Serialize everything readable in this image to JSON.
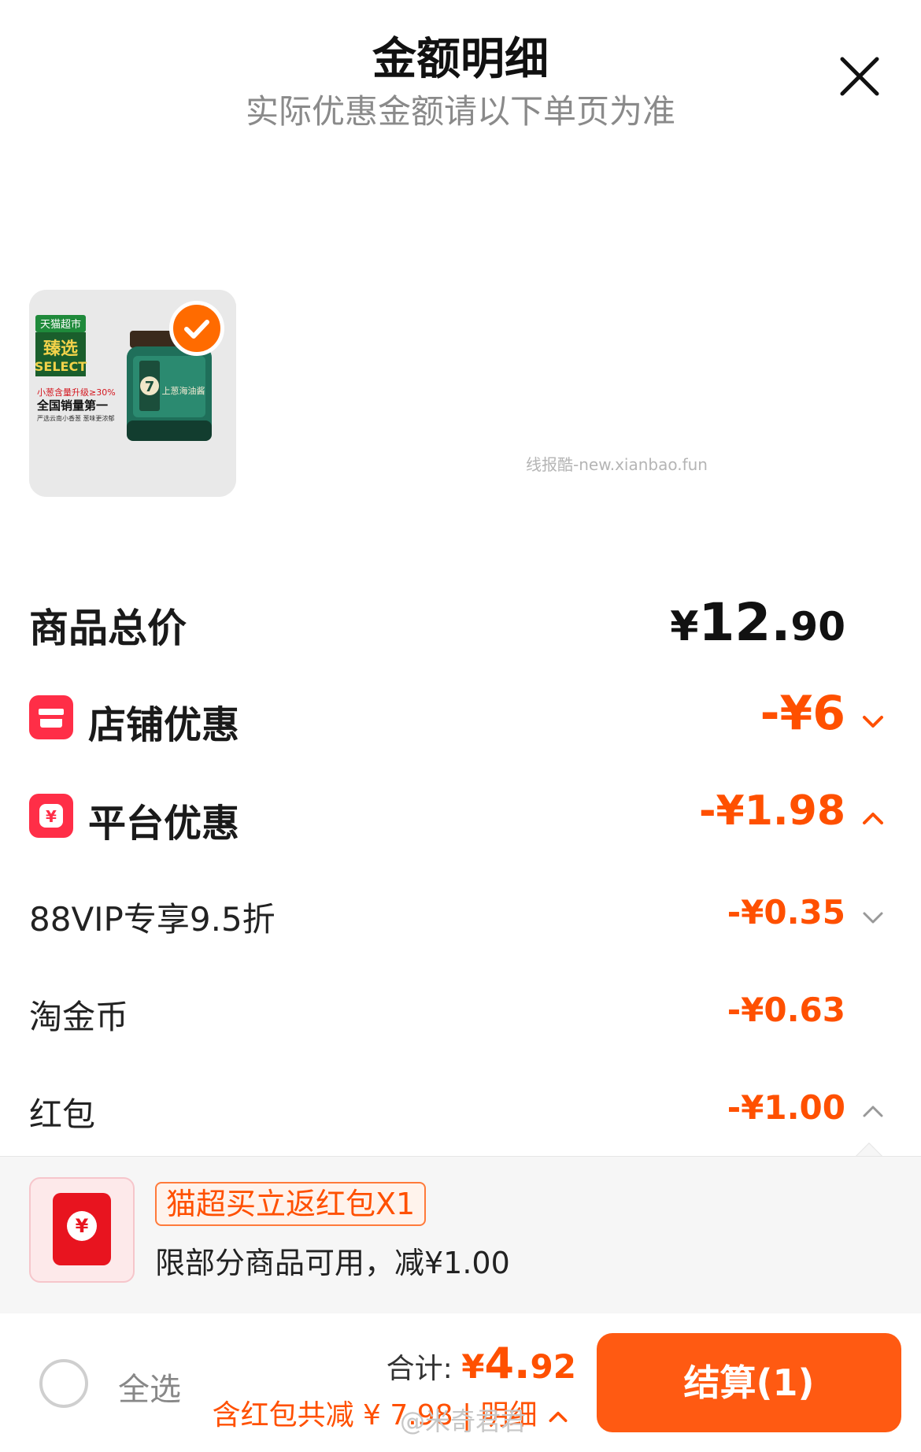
{
  "header": {
    "title": "金额明细",
    "subtitle": "实际优惠金额请以下单页为准"
  },
  "product": {
    "badge_top": "天猫超市",
    "badge_main": "臻选",
    "badge_sub": "SELECT",
    "promo_line1": "小葱含量升级≥30%",
    "promo_line2": "全国销量第一",
    "promo_line3": "严选云南小香葱 葱味更浓郁",
    "jar_label": "上葱海油酱",
    "jar_number": "7",
    "selected": true
  },
  "watermark": "线报酷-new.xianbao.fun",
  "summary": {
    "total_label": "商品总价",
    "total_currency": "¥",
    "total_integer": "12.",
    "total_decimal": "90",
    "store_label": "店铺优惠",
    "store_amount": "-¥6",
    "platform_label": "平台优惠",
    "platform_amount": "-¥1.98",
    "vip_label": "88VIP专享9.5折",
    "vip_amount": "-¥0.35",
    "coin_label": "淘金币",
    "coin_amount": "-¥0.63",
    "redpacket_label": "红包",
    "redpacket_amount": "-¥1.00"
  },
  "redpacket_detail": {
    "coin_symbol": "¥",
    "tag": "猫超买立返红包X1",
    "description": "限部分商品可用，减¥1.00"
  },
  "bottom": {
    "select_all": "全选",
    "total_label": "合计: ",
    "total_currency": "¥",
    "total_integer": "4.",
    "total_decimal": "92",
    "discount_text": "含红包共减 ¥ 7.98 | 明细",
    "checkout": "结算(1)",
    "user_watermark": "@米奇君君"
  },
  "colors": {
    "accent": "#ff5000",
    "checkout": "#ff5a12",
    "icon_red": "#ff2e47"
  }
}
